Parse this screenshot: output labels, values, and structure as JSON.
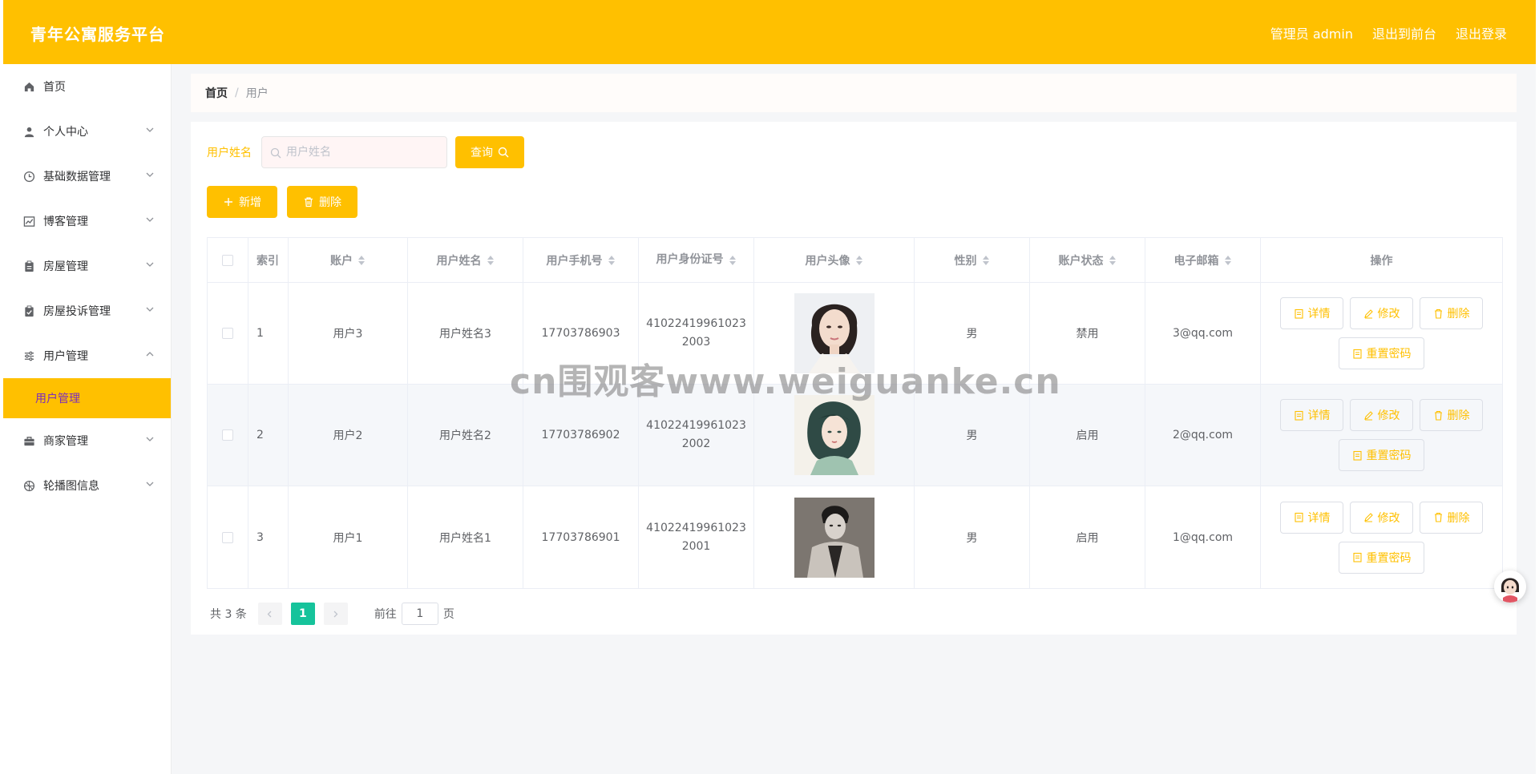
{
  "header": {
    "title": "青年公寓服务平台",
    "admin_label": "管理员 admin",
    "front_link": "退出到前台",
    "logout_link": "退出登录"
  },
  "sidebar": {
    "items": [
      {
        "label": "首页",
        "icon": "home-icon"
      },
      {
        "label": "个人中心",
        "icon": "user-icon"
      },
      {
        "label": "基础数据管理",
        "icon": "clock-icon"
      },
      {
        "label": "博客管理",
        "icon": "chart-icon"
      },
      {
        "label": "房屋管理",
        "icon": "clipboard-icon"
      },
      {
        "label": "房屋投诉管理",
        "icon": "clipboard-check-icon"
      },
      {
        "label": "用户管理",
        "icon": "sliders-icon"
      },
      {
        "label": "商家管理",
        "icon": "briefcase-icon"
      },
      {
        "label": "轮播图信息",
        "icon": "aperture-icon"
      }
    ],
    "active_sub": "用户管理"
  },
  "breadcrumb": {
    "home": "首页",
    "sep": "/",
    "current": "用户"
  },
  "search": {
    "label": "用户姓名",
    "placeholder": "用户姓名",
    "value": "",
    "button": "查询"
  },
  "actions": {
    "add": "新增",
    "delete": "删除"
  },
  "table": {
    "columns": [
      "索引",
      "账户",
      "用户姓名",
      "用户手机号",
      "用户身份证号",
      "用户头像",
      "性别",
      "账户状态",
      "电子邮箱",
      "操作"
    ],
    "rows": [
      {
        "index": "1",
        "account": "用户3",
        "name": "用户姓名3",
        "phone": "17703786903",
        "id_line1": "41022419961023",
        "id_line2": "2003",
        "avatar": "portrait-woman-white-dress",
        "sex": "男",
        "status": "禁用",
        "email": "3@qq.com"
      },
      {
        "index": "2",
        "account": "用户2",
        "name": "用户姓名2",
        "phone": "17703786902",
        "id_line1": "41022419961023",
        "id_line2": "2002",
        "avatar": "illustrated-woman-green",
        "sex": "男",
        "status": "启用",
        "email": "2@qq.com"
      },
      {
        "index": "3",
        "account": "用户1",
        "name": "用户姓名1",
        "phone": "17703786901",
        "id_line1": "41022419961023",
        "id_line2": "2001",
        "avatar": "portrait-man-bw",
        "sex": "男",
        "status": "启用",
        "email": "1@qq.com"
      }
    ],
    "op_labels": {
      "detail": "详情",
      "edit": "修改",
      "delete": "删除",
      "reset": "重置密码"
    }
  },
  "pagination": {
    "total": "共 3 条",
    "current_page": "1",
    "goto_prefix": "前往",
    "goto_value": "1",
    "goto_suffix": "页"
  },
  "watermark": "cn围观客www.weiguanke.cn",
  "colors": {
    "accent": "#ffc000",
    "page_active": "#16c39b",
    "submenu_text": "#7b2cbf"
  }
}
